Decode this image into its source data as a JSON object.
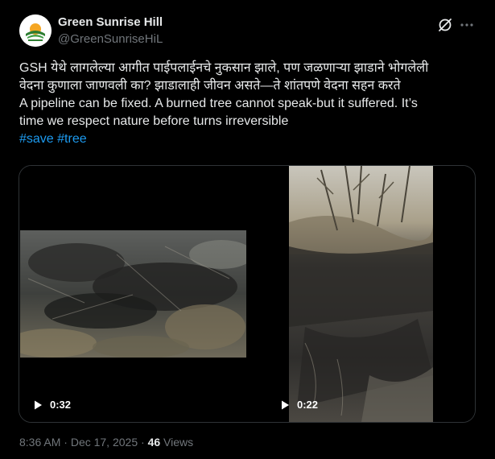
{
  "author": {
    "name": "Green Sunrise Hill",
    "handle": "@GreenSunriseHiL",
    "avatar_icon": "green-sunrise-logo",
    "brand_color": "#2e7d32"
  },
  "header_icons": {
    "grok": "grok-icon",
    "more": "more-options-icon"
  },
  "post": {
    "lines": [
      "GSH येथे लागलेल्या आगीत पाईपलाईनचे नुकसान झाले, पण जळणाऱ्या झाडाने भोगलेली",
      "वेदना कुणाला जाणवली का? झाडालाही जीवन असते—ते शांतपणे वेदना सहन करते",
      "A pipeline can be fixed. A burned tree cannot speak-but it suffered. It’s",
      "time we respect nature before turns irreversible"
    ],
    "hashtags": [
      "#save",
      "#tree"
    ]
  },
  "media": {
    "videos": [
      {
        "duration": "0:32",
        "icon": "play-icon"
      },
      {
        "duration": "0:22",
        "icon": "play-icon"
      }
    ]
  },
  "footer": {
    "time": "8:36 AM",
    "separator": "·",
    "date": "Dec 17, 2025",
    "views_count": "46",
    "views_label": "Views"
  },
  "colors": {
    "background": "#000000",
    "text": "#e7e9ea",
    "secondary": "#71767b",
    "link": "#1d9bf0",
    "border": "#2f3336"
  }
}
